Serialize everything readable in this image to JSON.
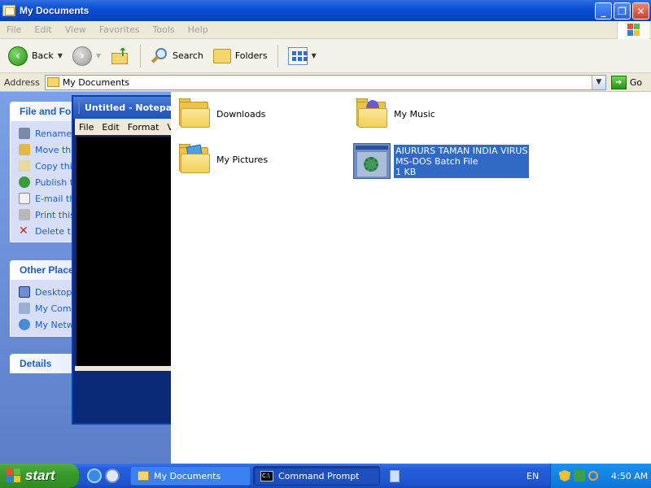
{
  "window": {
    "title": "My Documents"
  },
  "menu": [
    "File",
    "Edit",
    "View",
    "Favorites",
    "Tools",
    "Help"
  ],
  "toolbar": {
    "back": "Back",
    "search": "Search",
    "folders": "Folders"
  },
  "address": {
    "label": "Address",
    "value": "My Documents",
    "go": "Go"
  },
  "taskpane": {
    "file_tasks": {
      "title": "File and Fol",
      "items": [
        "Rename",
        "Move th",
        "Copy thi",
        "Publish t",
        "E-mail th",
        "Print this",
        "Delete th"
      ]
    },
    "other_places": {
      "title": "Other Place",
      "items": [
        "Desktop",
        "My Comp",
        "My Netw"
      ]
    },
    "details": {
      "title": "Details"
    }
  },
  "notepad": {
    "title": "Untitled - Notepad",
    "menu": [
      "File",
      "Edit",
      "Format",
      "Vi"
    ]
  },
  "files": [
    {
      "name": "Downloads"
    },
    {
      "name": "My Music"
    },
    {
      "name": "My Pictures"
    },
    {
      "name": "AIURURS TAMAN INDIA VIRUS",
      "type": "MS-DOS Batch File",
      "size": "1 KB"
    }
  ],
  "taskbar": {
    "start": "start",
    "tasks": [
      "My Documents",
      "Command Prompt"
    ],
    "cmd_icon_text": "C:\\",
    "lang": "EN",
    "time": "4:50 AM"
  },
  "colors": {
    "selection": "#316ac5",
    "task_link": "#215dc6",
    "title_bar": "#0a4fd6",
    "start": "#3a9a2c"
  }
}
